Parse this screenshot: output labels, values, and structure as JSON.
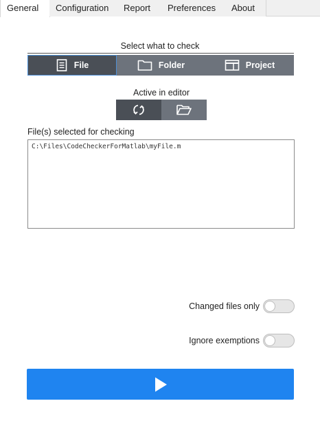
{
  "tabs": [
    {
      "label": "General",
      "active": true
    },
    {
      "label": "Configuration",
      "active": false
    },
    {
      "label": "Report",
      "active": false
    },
    {
      "label": "Preferences",
      "active": false
    },
    {
      "label": "About",
      "active": false
    }
  ],
  "check_target": {
    "heading": "Select what to check",
    "options": [
      {
        "label": "File",
        "icon": "document-icon",
        "selected": true
      },
      {
        "label": "Folder",
        "icon": "folder-icon",
        "selected": false
      },
      {
        "label": "Project",
        "icon": "project-window-icon",
        "selected": false
      }
    ]
  },
  "active_editor": {
    "heading": "Active in editor",
    "buttons": [
      {
        "icon": "refresh-icon",
        "selected": true
      },
      {
        "icon": "open-folder-icon",
        "selected": false
      }
    ]
  },
  "files": {
    "heading": "File(s) selected for checking",
    "items": [
      "C:\\Files\\CodeCheckerForMatlab\\myFile.m"
    ]
  },
  "options": {
    "changed_files_only": {
      "label": "Changed files only",
      "on": false
    },
    "ignore_exemptions": {
      "label": "Ignore exemptions",
      "on": false
    }
  },
  "run": {
    "icon": "play-icon"
  },
  "colors": {
    "accent": "#1f84f0",
    "segment": "#6d737c",
    "segment_selected": "#4a4f56",
    "selection_border": "#4d8fd6"
  }
}
